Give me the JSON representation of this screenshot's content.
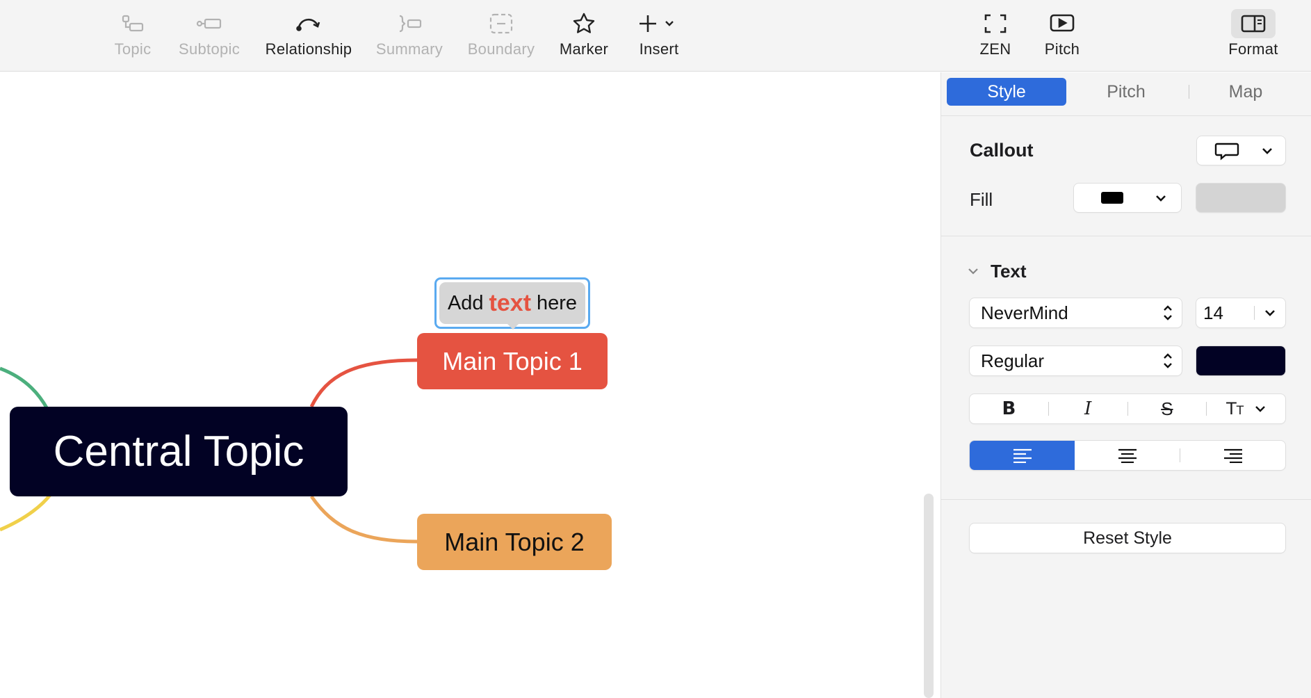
{
  "toolbar": {
    "topic": "Topic",
    "subtopic": "Subtopic",
    "relationship": "Relationship",
    "summary": "Summary",
    "boundary": "Boundary",
    "marker": "Marker",
    "insert": "Insert",
    "zen": "ZEN",
    "pitch": "Pitch",
    "format": "Format"
  },
  "canvas": {
    "central_topic": "Central Topic",
    "main_topic_1": "Main Topic 1",
    "main_topic_2": "Main Topic 2",
    "callout": {
      "prefix": "Add",
      "highlight": "text",
      "suffix": "here"
    },
    "colors": {
      "central": "#020224",
      "main1": "#e55341",
      "main2": "#eba55a",
      "branch_green": "#4caf7d",
      "branch_yellow": "#f0d04a",
      "selection": "#5aaaf0"
    }
  },
  "panel": {
    "tabs": [
      "Style",
      "Pitch",
      "Map"
    ],
    "active_tab": "Style",
    "callout_label": "Callout",
    "fill_label": "Fill",
    "fill_color": "#000000",
    "text_section": "Text",
    "font_family": "NeverMind",
    "font_size": "14",
    "font_weight": "Regular",
    "text_color": "#020224",
    "accent": "#2e6bdb",
    "reset_style": "Reset Style"
  }
}
